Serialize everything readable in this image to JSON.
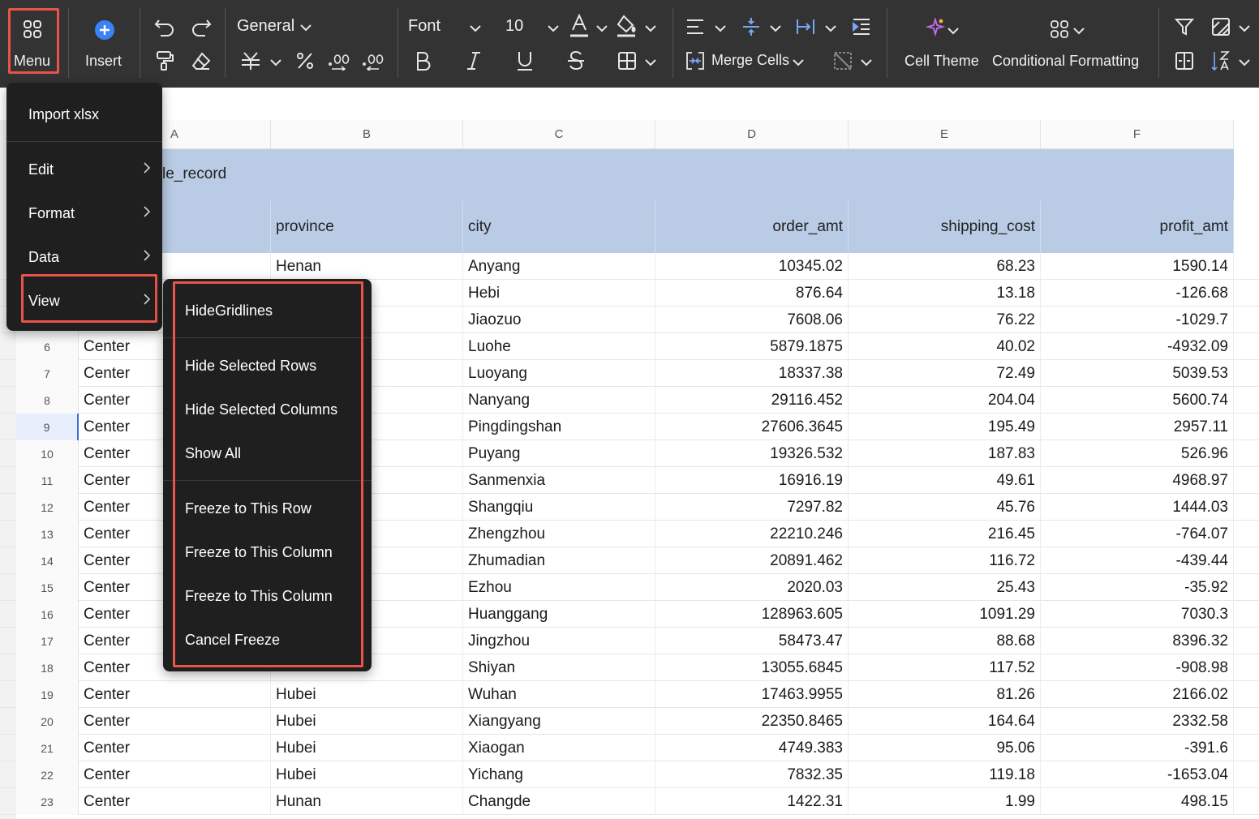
{
  "toolbar": {
    "menu_label": "Menu",
    "insert_label": "Insert",
    "number_format": "General",
    "font_name": "Font",
    "font_size": "10",
    "merge_cells_label": "Merge Cells",
    "cell_theme_label": "Cell Theme",
    "conditional_formatting_label": "Conditional Formatting"
  },
  "sheet": {
    "columns": [
      "A",
      "B",
      "C",
      "D",
      "E",
      "F"
    ],
    "title": "le_record",
    "headers": [
      "",
      "province",
      "city",
      "order_amt",
      "shipping_cost",
      "profit_amt"
    ],
    "rows": [
      {
        "num": "",
        "a": "",
        "b": "Henan",
        "c": "Anyang",
        "d": "10345.02",
        "e": "68.23",
        "f": "1590.14"
      },
      {
        "num": "",
        "a": "",
        "b": "",
        "c": "Hebi",
        "d": "876.64",
        "e": "13.18",
        "f": "-126.68"
      },
      {
        "num": "",
        "a": "",
        "b": "",
        "c": "Jiaozuo",
        "d": "7608.06",
        "e": "76.22",
        "f": "-1029.7"
      },
      {
        "num": "6",
        "a": "Center",
        "b": "",
        "c": "Luohe",
        "d": "5879.1875",
        "e": "40.02",
        "f": "-4932.09"
      },
      {
        "num": "7",
        "a": "Center",
        "b": "",
        "c": "Luoyang",
        "d": "18337.38",
        "e": "72.49",
        "f": "5039.53"
      },
      {
        "num": "8",
        "a": "Center",
        "b": "",
        "c": "Nanyang",
        "d": "29116.452",
        "e": "204.04",
        "f": "5600.74"
      },
      {
        "num": "9",
        "a": "Center",
        "b": "",
        "c": "Pingdingshan",
        "d": "27606.3645",
        "e": "195.49",
        "f": "2957.11"
      },
      {
        "num": "10",
        "a": "Center",
        "b": "",
        "c": "Puyang",
        "d": "19326.532",
        "e": "187.83",
        "f": "526.96"
      },
      {
        "num": "11",
        "a": "Center",
        "b": "",
        "c": "Sanmenxia",
        "d": "16916.19",
        "e": "49.61",
        "f": "4968.97"
      },
      {
        "num": "12",
        "a": "Center",
        "b": "",
        "c": "Shangqiu",
        "d": "7297.82",
        "e": "45.76",
        "f": "1444.03"
      },
      {
        "num": "13",
        "a": "Center",
        "b": "",
        "c": "Zhengzhou",
        "d": "22210.246",
        "e": "216.45",
        "f": "-764.07"
      },
      {
        "num": "14",
        "a": "Center",
        "b": "",
        "c": "Zhumadian",
        "d": "20891.462",
        "e": "116.72",
        "f": "-439.44"
      },
      {
        "num": "15",
        "a": "Center",
        "b": "",
        "c": "Ezhou",
        "d": "2020.03",
        "e": "25.43",
        "f": "-35.92"
      },
      {
        "num": "16",
        "a": "Center",
        "b": "",
        "c": "Huanggang",
        "d": "128963.605",
        "e": "1091.29",
        "f": "7030.3"
      },
      {
        "num": "17",
        "a": "Center",
        "b": "",
        "c": "Jingzhou",
        "d": "58473.47",
        "e": "88.68",
        "f": "8396.32"
      },
      {
        "num": "18",
        "a": "Center",
        "b": "",
        "c": "Shiyan",
        "d": "13055.6845",
        "e": "117.52",
        "f": "-908.98"
      },
      {
        "num": "19",
        "a": "Center",
        "b": "Hubei",
        "c": "Wuhan",
        "d": "17463.9955",
        "e": "81.26",
        "f": "2166.02"
      },
      {
        "num": "20",
        "a": "Center",
        "b": "Hubei",
        "c": "Xiangyang",
        "d": "22350.8465",
        "e": "164.64",
        "f": "2332.58"
      },
      {
        "num": "21",
        "a": "Center",
        "b": "Hubei",
        "c": "Xiaogan",
        "d": "4749.383",
        "e": "95.06",
        "f": "-391.6"
      },
      {
        "num": "22",
        "a": "Center",
        "b": "Hubei",
        "c": "Yichang",
        "d": "7832.35",
        "e": "119.18",
        "f": "-1653.04"
      },
      {
        "num": "23",
        "a": "Center",
        "b": "Hunan",
        "c": "Changde",
        "d": "1422.31",
        "e": "1.99",
        "f": "498.15"
      }
    ],
    "selected_row": "9"
  },
  "menu": {
    "import": "Import xlsx",
    "edit": "Edit",
    "format": "Format",
    "data": "Data",
    "view": "View"
  },
  "view_submenu": {
    "hide_gridlines": "HideGridlines",
    "hide_selected_rows": "Hide Selected Rows",
    "hide_selected_columns": "Hide Selected Columns",
    "show_all": "Show All",
    "freeze_row": "Freeze to This Row",
    "freeze_column_1": "Freeze to This Column",
    "freeze_column_2": "Freeze to This Column",
    "cancel_freeze": "Cancel Freeze"
  },
  "colors": {
    "toolbar_bg": "#333333",
    "menu_bg": "#1f1f1f",
    "highlight_red": "#e8534a",
    "header_blue": "#b9cbe5",
    "insert_icon_blue": "#3b82f6"
  }
}
